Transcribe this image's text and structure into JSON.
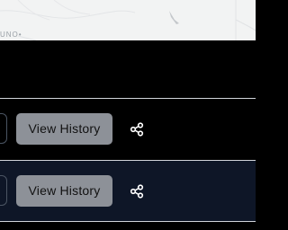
{
  "map": {
    "attribution": "UNO•"
  },
  "rows": [
    {
      "history_label": "View History",
      "share_icon": "share-icon"
    },
    {
      "history_label": "View History",
      "share_icon": "share-icon"
    }
  ],
  "colors": {
    "button_bg": "#8d9198",
    "row_alt_bg": "#0e1627",
    "divider": "#d1d5db"
  }
}
